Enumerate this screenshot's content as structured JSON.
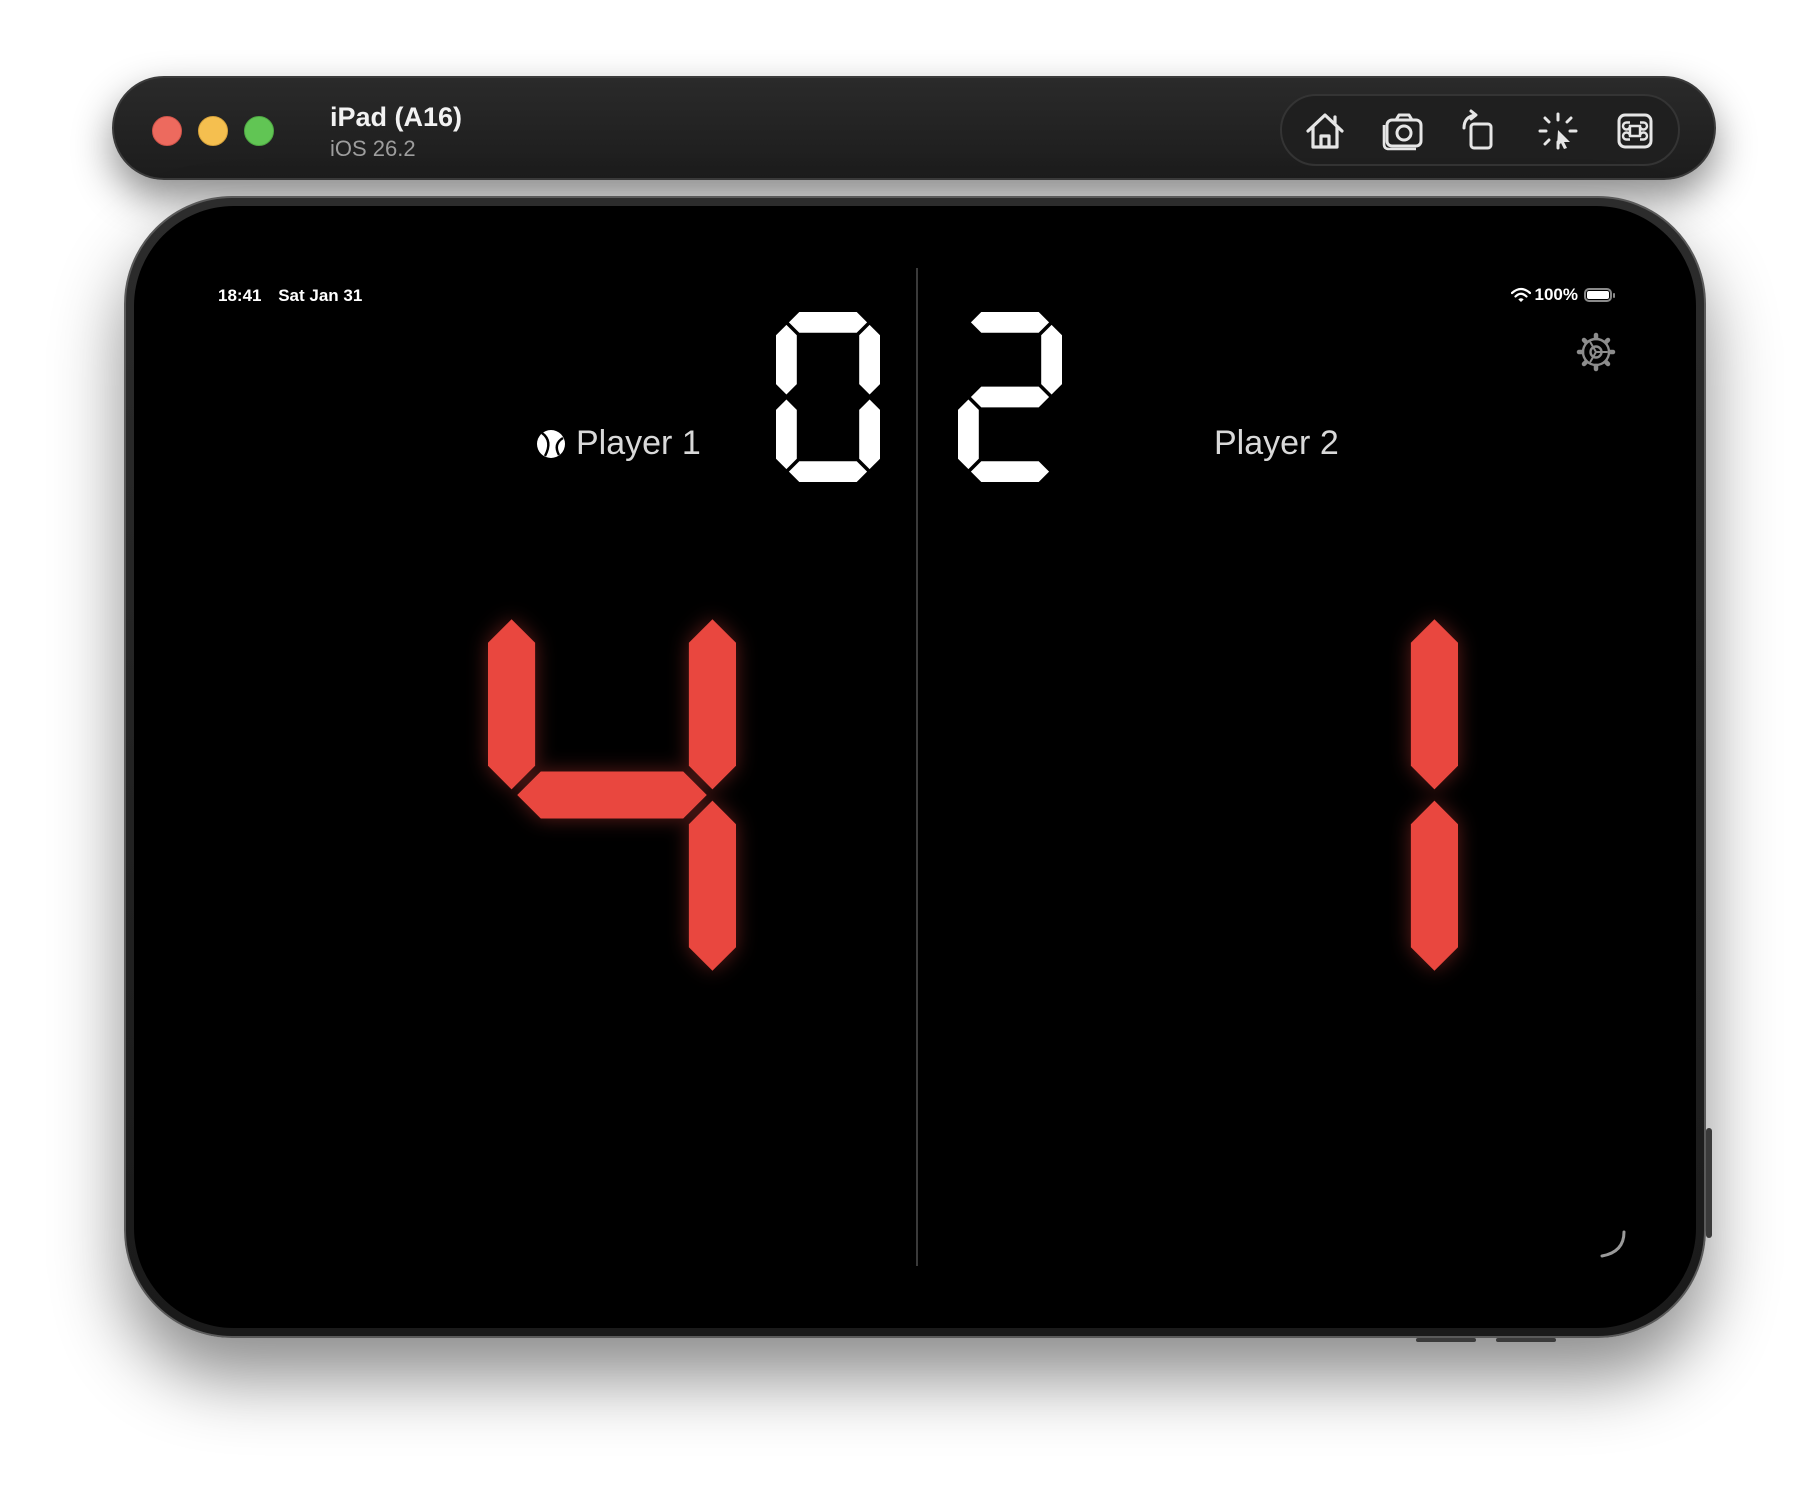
{
  "window": {
    "device_name": "iPad (A16)",
    "os_version": "iOS 26.2",
    "toolbar_icons": [
      "home-icon",
      "screenshot-icon",
      "rotate-icon",
      "shake-icon",
      "command-icon"
    ]
  },
  "status_bar": {
    "time": "18:41",
    "date": "Sat Jan 31",
    "battery": "100%"
  },
  "scoreboard": {
    "player1": {
      "name": "Player 1",
      "sets": 0,
      "points": 4,
      "serving": true
    },
    "player2": {
      "name": "Player 2",
      "sets": 2,
      "points": 1,
      "serving": false
    }
  },
  "colors": {
    "points_color": "#e9473f",
    "sets_color": "#ffffff",
    "background": "#000000"
  },
  "icons": {
    "settings": "gear-icon",
    "serve_indicator": "ball-icon"
  }
}
